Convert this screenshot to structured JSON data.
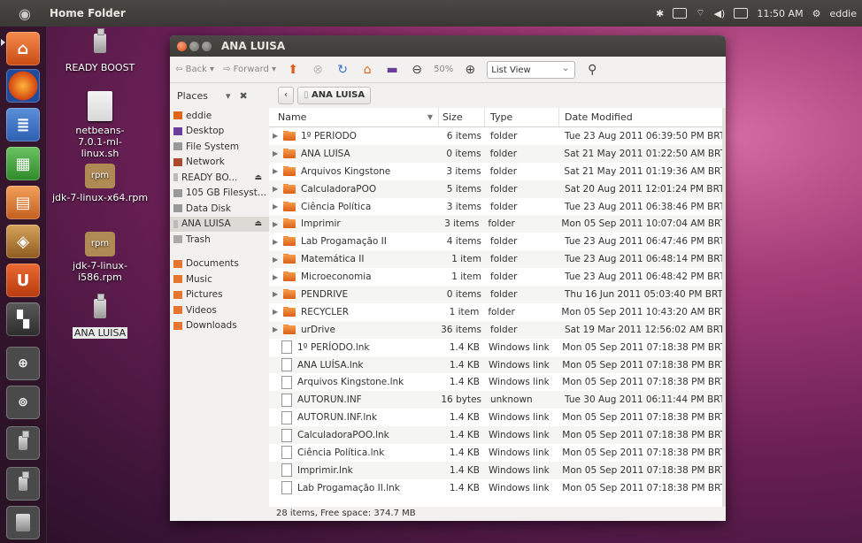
{
  "top_panel": {
    "title": "Home Folder",
    "clock": "11:50 AM",
    "user": "eddie"
  },
  "desktop": {
    "icons": [
      {
        "label": "READY BOOST"
      },
      {
        "label": "netbeans-7.0.1-ml-linux.sh"
      },
      {
        "label": "jdk-7-linux-x64.rpm"
      },
      {
        "label": "jdk-7-linux-i586.rpm"
      },
      {
        "label": "ANA LUISA"
      }
    ]
  },
  "window": {
    "title": "ANA LUISA",
    "toolbar": {
      "back": "Back",
      "forward": "Forward",
      "zoom": "50%",
      "view": "List View"
    },
    "sidebar": {
      "header": "Places",
      "items": [
        {
          "label": "eddie"
        },
        {
          "label": "Desktop"
        },
        {
          "label": "File System"
        },
        {
          "label": "Network"
        },
        {
          "label": "READY BO..."
        },
        {
          "label": "105 GB Filesyst..."
        },
        {
          "label": "Data Disk"
        },
        {
          "label": "ANA LUISA"
        },
        {
          "label": "Trash"
        },
        {
          "label": "Documents"
        },
        {
          "label": "Music"
        },
        {
          "label": "Pictures"
        },
        {
          "label": "Videos"
        },
        {
          "label": "Downloads"
        }
      ]
    },
    "path": "ANA LUISA",
    "columns": {
      "name": "Name",
      "size": "Size",
      "type": "Type",
      "date": "Date Modified"
    },
    "rows": [
      {
        "name": "1º PERÍODO",
        "size": "6 items",
        "type": "folder",
        "date": "Tue 23 Aug 2011 06:39:50 PM BRT"
      },
      {
        "name": "ANA LUÍSA",
        "size": "0 items",
        "type": "folder",
        "date": "Sat 21 May 2011 01:22:50 AM BRT"
      },
      {
        "name": "Arquivos Kingstone",
        "size": "3 items",
        "type": "folder",
        "date": "Sat 21 May 2011 01:19:36 AM BRT"
      },
      {
        "name": "CalculadoraPOO",
        "size": "5 items",
        "type": "folder",
        "date": "Sat 20 Aug 2011 12:01:24 PM BRT"
      },
      {
        "name": "Ciência Política",
        "size": "3 items",
        "type": "folder",
        "date": "Tue 23 Aug 2011 06:38:46 PM BRT"
      },
      {
        "name": "Imprimir",
        "size": "3 items",
        "type": "folder",
        "date": "Mon 05 Sep 2011 10:07:04 AM BRT"
      },
      {
        "name": "Lab Progamação II",
        "size": "4 items",
        "type": "folder",
        "date": "Tue 23 Aug 2011 06:47:46 PM BRT"
      },
      {
        "name": "Matemática II",
        "size": "1 item",
        "type": "folder",
        "date": "Tue 23 Aug 2011 06:48:14 PM BRT"
      },
      {
        "name": "Microeconomia",
        "size": "1 item",
        "type": "folder",
        "date": "Tue 23 Aug 2011 06:48:42 PM BRT"
      },
      {
        "name": "PENDRIVE",
        "size": "0 items",
        "type": "folder",
        "date": "Thu 16 Jun 2011 05:03:40 PM BRT"
      },
      {
        "name": "RECYCLER",
        "size": "1 item",
        "type": "folder",
        "date": "Mon 05 Sep 2011 10:43:20 AM BRT"
      },
      {
        "name": "urDrive",
        "size": "36 items",
        "type": "folder",
        "date": "Sat 19 Mar 2011 12:56:02 AM BRT"
      },
      {
        "name": "1º PERÍODO.lnk",
        "size": "1.4 KB",
        "type": "Windows link",
        "date": "Mon 05 Sep 2011 07:18:38 PM BRT"
      },
      {
        "name": "ANA LUÍSA.lnk",
        "size": "1.4 KB",
        "type": "Windows link",
        "date": "Mon 05 Sep 2011 07:18:38 PM BRT"
      },
      {
        "name": "Arquivos Kingstone.lnk",
        "size": "1.4 KB",
        "type": "Windows link",
        "date": "Mon 05 Sep 2011 07:18:38 PM BRT"
      },
      {
        "name": "AUTORUN.INF",
        "size": "16 bytes",
        "type": "unknown",
        "date": "Tue 30 Aug 2011 06:11:44 PM BRT"
      },
      {
        "name": "AUTORUN.INF.lnk",
        "size": "1.4 KB",
        "type": "Windows link",
        "date": "Mon 05 Sep 2011 07:18:38 PM BRT"
      },
      {
        "name": "CalculadoraPOO.lnk",
        "size": "1.4 KB",
        "type": "Windows link",
        "date": "Mon 05 Sep 2011 07:18:38 PM BRT"
      },
      {
        "name": "Ciência Política.lnk",
        "size": "1.4 KB",
        "type": "Windows link",
        "date": "Mon 05 Sep 2011 07:18:38 PM BRT"
      },
      {
        "name": "Imprimir.lnk",
        "size": "1.4 KB",
        "type": "Windows link",
        "date": "Mon 05 Sep 2011 07:18:38 PM BRT"
      },
      {
        "name": "Lab Progamação II.lnk",
        "size": "1.4 KB",
        "type": "Windows link",
        "date": "Mon 05 Sep 2011 07:18:38 PM BRT"
      }
    ],
    "status": "28 items, Free space: 374.7 MB"
  },
  "colors": {
    "accent": "#dd4814",
    "folder": "#e8752f"
  }
}
